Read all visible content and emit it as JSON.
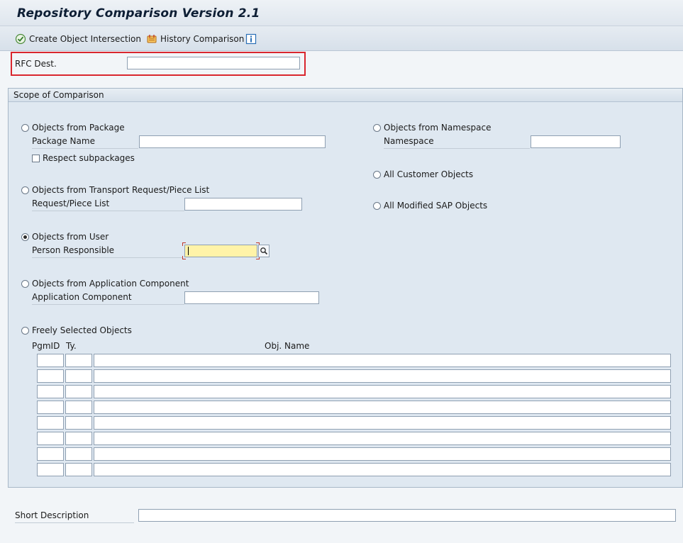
{
  "window": {
    "title": "Repository Comparison Version 2.1"
  },
  "toolbar": {
    "create_intersection_label": "Create Object Intersection",
    "history_comparison_label": "History Comparison",
    "info_icon": "info-icon"
  },
  "rfc": {
    "label": "RFC Dest.",
    "value": ""
  },
  "scope": {
    "header": "Scope of Comparison",
    "options": {
      "package": {
        "label": "Objects from Package",
        "checked": false,
        "field_label": "Package Name",
        "subpackages_label": "Respect subpackages"
      },
      "transport": {
        "label": "Objects from Transport Request/Piece List",
        "checked": false,
        "field_label": "Request/Piece List"
      },
      "user": {
        "label": "Objects from User",
        "checked": true,
        "field_label": "Person Responsible"
      },
      "app_component": {
        "label": "Objects from Application Component",
        "checked": false,
        "field_label": "Application Component"
      },
      "free": {
        "label": "Freely Selected Objects",
        "checked": false
      },
      "namespace": {
        "label": "Objects from Namespace",
        "checked": false,
        "field_label": "Namespace"
      },
      "customer": {
        "label": "All Customer Objects",
        "checked": false
      },
      "modified_sap": {
        "label": "All Modified SAP Objects",
        "checked": false
      }
    },
    "table": {
      "headers": [
        "PgmID",
        "Ty.",
        "Obj. Name"
      ],
      "rows": 8
    }
  },
  "short_description": {
    "label": "Short Description",
    "value": ""
  },
  "colors": {
    "highlight_border": "#d9262e",
    "focus_field": "#fff3a8",
    "group_bg": "#dfe8f1"
  }
}
